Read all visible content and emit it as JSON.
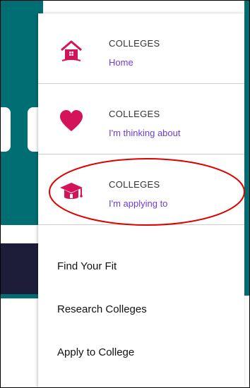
{
  "menu": {
    "items": [
      {
        "kicker": "COLLEGES",
        "link": "Home",
        "icon": "house-icon"
      },
      {
        "kicker": "COLLEGES",
        "link": "I'm thinking about",
        "icon": "heart-icon"
      },
      {
        "kicker": "COLLEGES",
        "link": "I'm applying to",
        "icon": "graduation-cap-icon"
      }
    ],
    "links": [
      {
        "label": "Find Your Fit"
      },
      {
        "label": "Research Colleges"
      },
      {
        "label": "Apply to College"
      }
    ]
  },
  "colors": {
    "teal": "#006e73",
    "navy": "#1d1d3a",
    "accent_pink": "#d4145a",
    "link_purple": "#6f3bd9",
    "annotation_red": "#e00000"
  }
}
